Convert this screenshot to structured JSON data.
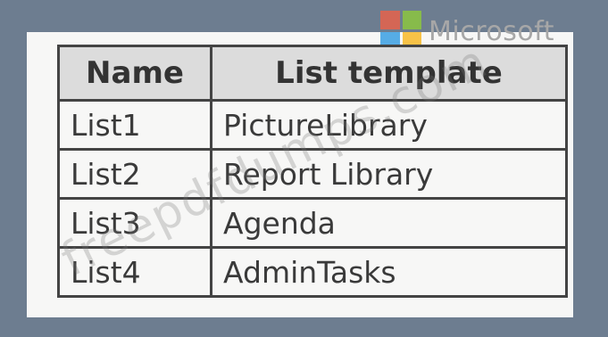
{
  "logo": {
    "wordmark": "Microsoft",
    "colors": [
      "#e7634b",
      "#8cc63f",
      "#3aa0e3",
      "#f7b929"
    ]
  },
  "table": {
    "headers": [
      "Name",
      "List template"
    ],
    "rows": [
      [
        "List1",
        "PictureLibrary"
      ],
      [
        "List2",
        "Report Library"
      ],
      [
        "List3",
        "Agenda"
      ],
      [
        "List4",
        "AdminTasks"
      ]
    ]
  },
  "watermark": {
    "text": "freepdfdumps.com"
  }
}
